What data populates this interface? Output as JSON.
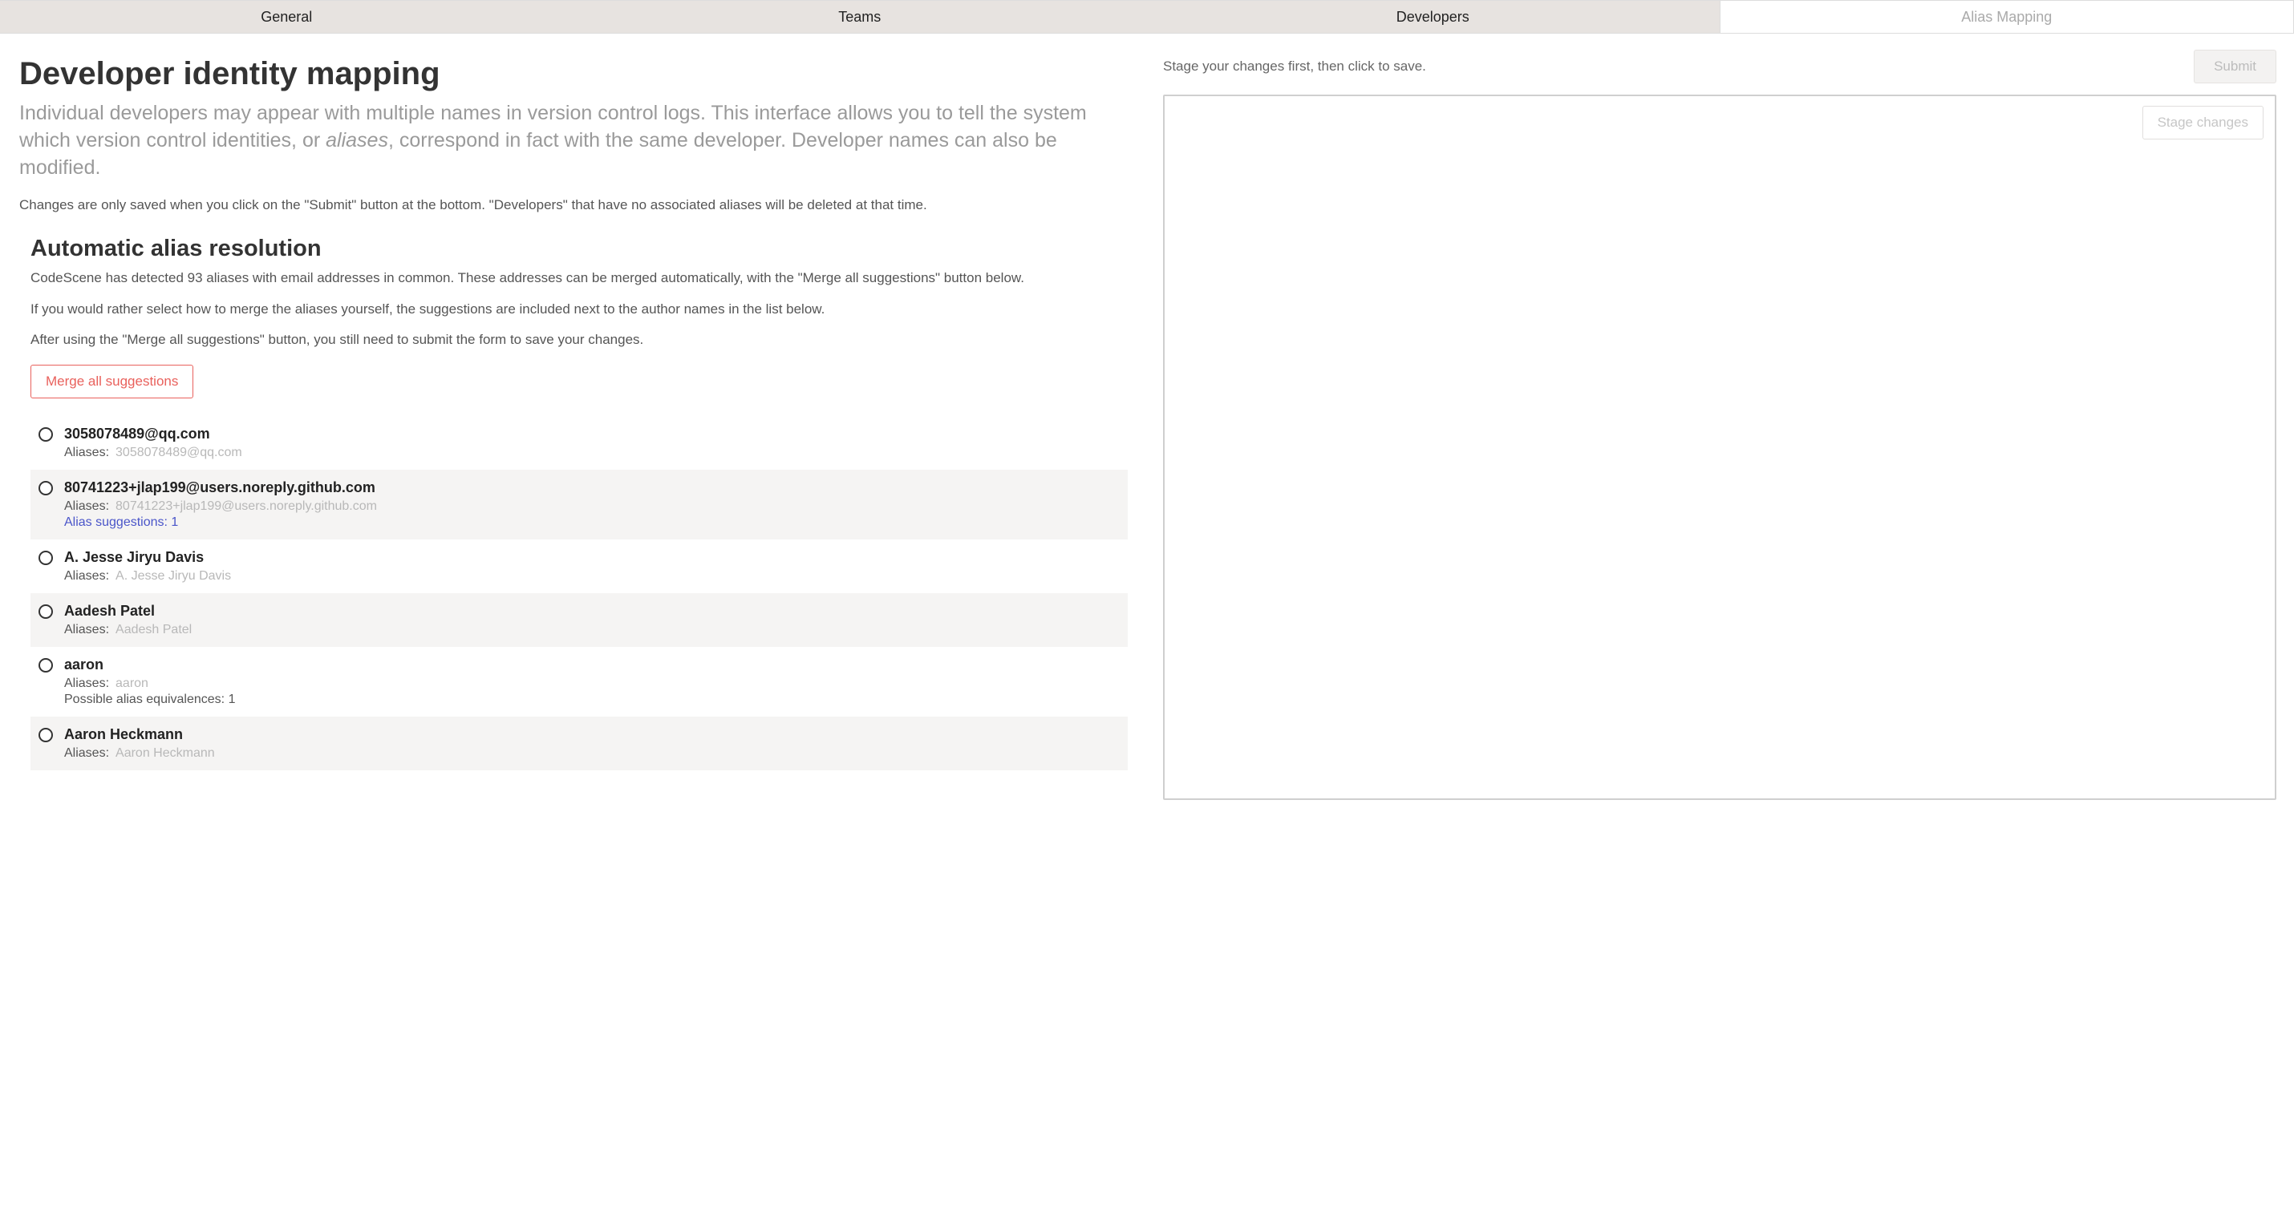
{
  "tabs": {
    "items": [
      {
        "label": "General",
        "active": false
      },
      {
        "label": "Teams",
        "active": false
      },
      {
        "label": "Developers",
        "active": false
      },
      {
        "label": "Alias Mapping",
        "active": true
      }
    ]
  },
  "page": {
    "title": "Developer identity mapping",
    "lead_pre": "Individual developers may appear with multiple names in version control logs. This interface allows you to tell the system which version control identities, or ",
    "lead_em": "aliases",
    "lead_post": ", correspond in fact with the same developer. Developer names can also be modified.",
    "note": "Changes are only saved when you click on the \"Submit\" button at the bottom. \"Developers\" that have no associated aliases will be deleted at that time."
  },
  "auto": {
    "title": "Automatic alias resolution",
    "p1": "CodeScene has detected 93 aliases with email addresses in common. These addresses can be merged automatically, with the \"Merge all suggestions\" button below.",
    "p2": "If you would rather select how to merge the aliases yourself, the suggestions are included next to the author names in the list below.",
    "p3": "After using the \"Merge all suggestions\" button, you still need to submit the form to save your changes.",
    "merge_button": "Merge all suggestions"
  },
  "labels": {
    "aliases": "Aliases:"
  },
  "developers": [
    {
      "name": "3058078489@qq.com",
      "aliases": "3058078489@qq.com",
      "suggestion": null,
      "equivalences": null,
      "shade": false
    },
    {
      "name": "80741223+jlap199@users.noreply.github.com",
      "aliases": "80741223+jlap199@users.noreply.github.com",
      "suggestion": "Alias suggestions: 1",
      "equivalences": null,
      "shade": true
    },
    {
      "name": "A. Jesse Jiryu Davis",
      "aliases": "A. Jesse Jiryu Davis",
      "suggestion": null,
      "equivalences": null,
      "shade": false
    },
    {
      "name": "Aadesh Patel",
      "aliases": "Aadesh Patel",
      "suggestion": null,
      "equivalences": null,
      "shade": true
    },
    {
      "name": "aaron",
      "aliases": "aaron",
      "suggestion": null,
      "equivalences": "Possible alias equivalences: 1",
      "shade": false
    },
    {
      "name": "Aaron Heckmann",
      "aliases": "Aaron Heckmann",
      "suggestion": null,
      "equivalences": null,
      "shade": true
    }
  ],
  "right": {
    "hint": "Stage your changes first, then click to save.",
    "submit": "Submit",
    "stage_changes": "Stage changes"
  }
}
